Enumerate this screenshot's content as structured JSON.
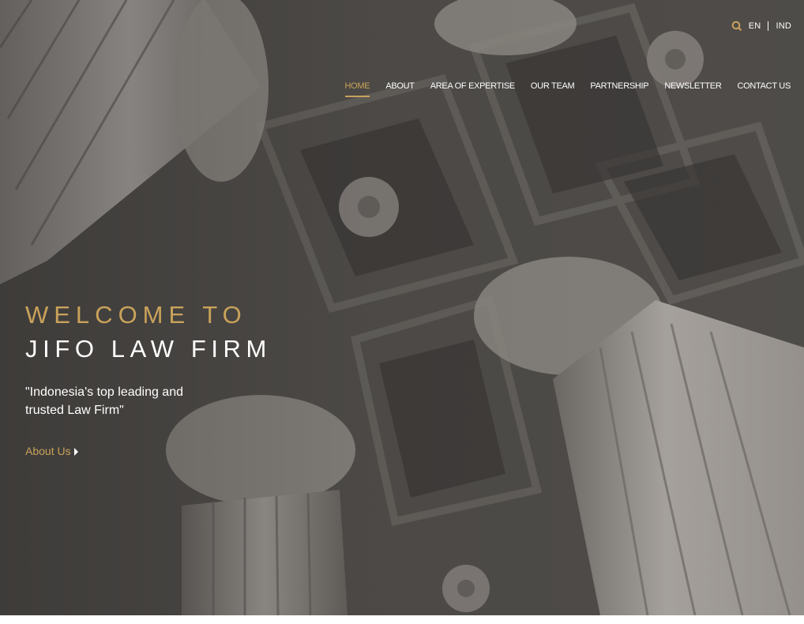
{
  "colors": {
    "accent": "#c9a25a",
    "text": "#ffffff",
    "hero_tint": "#4a4845"
  },
  "topbar": {
    "search_icon": "search-icon",
    "lang_en": "EN",
    "lang_ind": "IND"
  },
  "nav": {
    "items": [
      {
        "label": "HOME",
        "active": true
      },
      {
        "label": "ABOUT"
      },
      {
        "label": "AREA OF EXPERTISE"
      },
      {
        "label": "OUR TEAM"
      },
      {
        "label": "PARTNERSHIP"
      },
      {
        "label": "NEWSLETTER"
      },
      {
        "label": "CONTACT US"
      }
    ]
  },
  "hero": {
    "welcome": "WELCOME TO",
    "firm_name": "JIFO LAW FIRM",
    "tagline": "\"Indonesia's top leading and trusted Law Firm\"",
    "about_link": "About Us"
  }
}
